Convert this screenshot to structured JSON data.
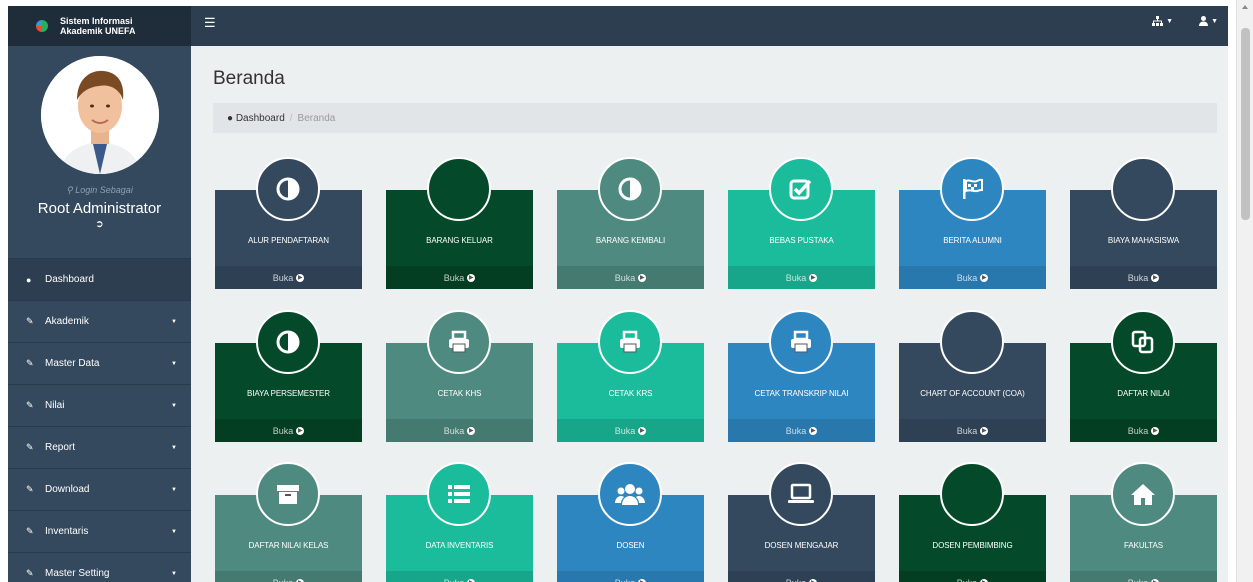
{
  "brand": {
    "line1": "Sistem Informasi",
    "line2": "Akademik UNEFA"
  },
  "topbar": {
    "menu_icon": "hamburger-icon",
    "right_icons": [
      "sitemap-icon",
      "user-icon"
    ]
  },
  "profile": {
    "login_as": "Login Sebagai",
    "role": "Root Administrator"
  },
  "sidebar": {
    "items": [
      {
        "label": "Dashboard",
        "icon": "dashboard-icon",
        "active": true,
        "has_caret": false
      },
      {
        "label": "Akademik",
        "icon": "edit-icon",
        "has_caret": true
      },
      {
        "label": "Master Data",
        "icon": "edit-icon",
        "has_caret": true
      },
      {
        "label": "Nilai",
        "icon": "edit-icon",
        "has_caret": true
      },
      {
        "label": "Report",
        "icon": "edit-icon",
        "has_caret": true
      },
      {
        "label": "Download",
        "icon": "edit-icon",
        "has_caret": true
      },
      {
        "label": "Inventaris",
        "icon": "edit-icon",
        "has_caret": true
      },
      {
        "label": "Master Setting",
        "icon": "edit-icon",
        "has_caret": true
      }
    ]
  },
  "main": {
    "title": "Beranda",
    "breadcrumb": {
      "home": "Dashboard",
      "current": "Beranda"
    }
  },
  "tiles": [
    {
      "label": "ALUR PENDAFTARAN",
      "icon": "adjust-icon",
      "color": "#34495e",
      "foot": "#2e4154",
      "button": "Buka"
    },
    {
      "label": "BARANG KELUAR",
      "icon": "blank-icon",
      "color": "#044a2a",
      "foot": "#033d22",
      "button": "Buka"
    },
    {
      "label": "BARANG KEMBALI",
      "icon": "adjust-icon",
      "color": "#4f8a80",
      "foot": "#457a71",
      "button": "Buka"
    },
    {
      "label": "BEBAS PUSTAKA",
      "icon": "check-square-icon",
      "color": "#1abc9c",
      "foot": "#17a689",
      "button": "Buka"
    },
    {
      "label": "BERITA ALUMNI",
      "icon": "flag-icon",
      "color": "#2e86c1",
      "foot": "#2877ad",
      "button": "Buka"
    },
    {
      "label": "BIAYA MAHASISWA",
      "icon": "blank-icon",
      "color": "#34495e",
      "foot": "#2e4154",
      "button": "Buka"
    },
    {
      "label": "BIAYA PERSEMESTER",
      "icon": "adjust-icon",
      "color": "#044a2a",
      "foot": "#033d22",
      "button": "Buka"
    },
    {
      "label": "CETAK KHS",
      "icon": "print-icon",
      "color": "#4f8a80",
      "foot": "#457a71",
      "button": "Buka"
    },
    {
      "label": "CETAK KRS",
      "icon": "print-icon",
      "color": "#1abc9c",
      "foot": "#17a689",
      "button": "Buka"
    },
    {
      "label": "CETAK TRANSKRIP NILAI",
      "icon": "print-icon",
      "color": "#2e86c1",
      "foot": "#2877ad",
      "button": "Buka"
    },
    {
      "label": "CHART OF ACCOUNT (COA)",
      "icon": "blank-icon",
      "color": "#34495e",
      "foot": "#2e4154",
      "button": "Buka"
    },
    {
      "label": "DAFTAR NILAI",
      "icon": "copy-icon",
      "color": "#044a2a",
      "foot": "#033d22",
      "button": "Buka"
    },
    {
      "label": "DAFTAR NILAI KELAS",
      "icon": "archive-icon",
      "color": "#4f8a80",
      "foot": "#457a71",
      "button": "Buka"
    },
    {
      "label": "DATA INVENTARIS",
      "icon": "list-icon",
      "color": "#1abc9c",
      "foot": "#17a689",
      "button": "Buka"
    },
    {
      "label": "DOSEN",
      "icon": "users-icon",
      "color": "#2e86c1",
      "foot": "#2877ad",
      "button": "Buka"
    },
    {
      "label": "DOSEN MENGAJAR",
      "icon": "laptop-icon",
      "color": "#34495e",
      "foot": "#2e4154",
      "button": "Buka"
    },
    {
      "label": "DOSEN PEMBIMBING",
      "icon": "blank-icon",
      "color": "#044a2a",
      "foot": "#033d22",
      "button": "Buka"
    },
    {
      "label": "FAKULTAS",
      "icon": "home-icon",
      "color": "#4f8a80",
      "foot": "#457a71",
      "button": "Buka"
    }
  ]
}
